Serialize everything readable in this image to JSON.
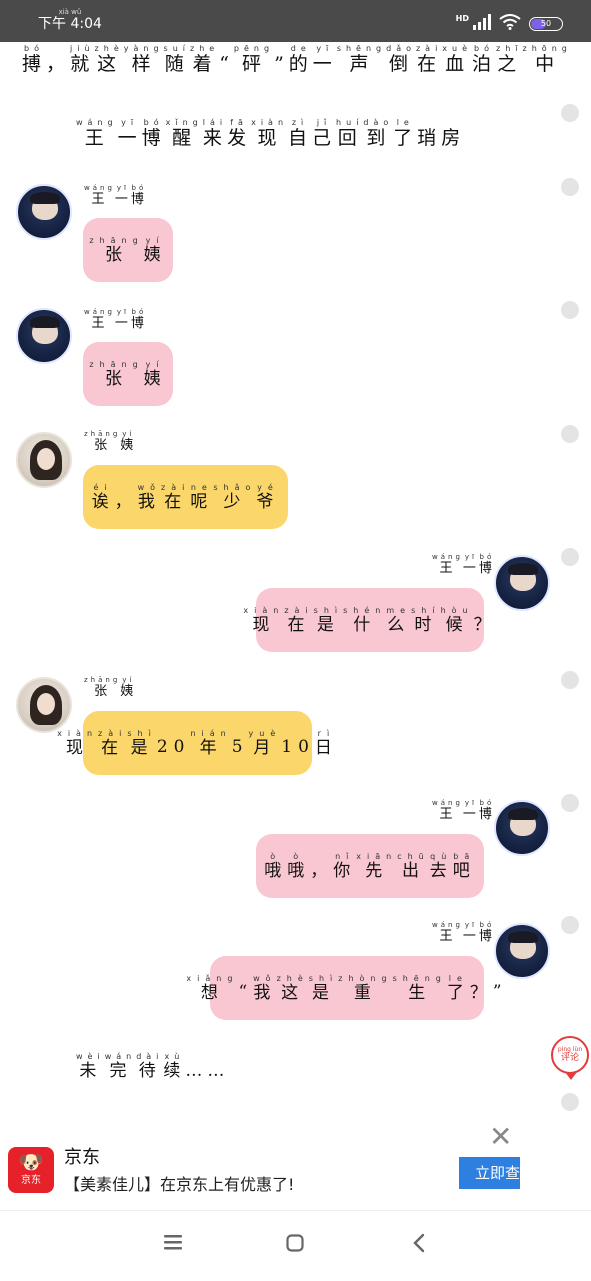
{
  "status_bar": {
    "time": "4:04",
    "time_prefix": "下午",
    "time_prefix_pinyin": "xià wǔ",
    "network": "HD",
    "battery": "50",
    "battery_level": 0.5
  },
  "story": {
    "lines": [
      {
        "chars": [
          [
            "搏",
            "bó"
          ],
          [
            "，",
            ""
          ],
          [
            "就",
            "jiù"
          ],
          [
            "这",
            "zhè"
          ],
          [
            "样",
            "yàng"
          ],
          [
            "随",
            "suí"
          ],
          [
            "着",
            "zhe"
          ],
          [
            "“",
            ""
          ],
          [
            "砰",
            "pēng"
          ],
          [
            "”",
            ""
          ],
          [
            "的",
            "de"
          ],
          [
            "一",
            "yī"
          ],
          [
            "声",
            "shēng"
          ],
          [
            "倒",
            "dǎo"
          ],
          [
            "在",
            "zài"
          ],
          [
            "血",
            "xuè"
          ],
          [
            "泊",
            "bó"
          ],
          [
            "之",
            "zhī"
          ],
          [
            "中",
            "zhōng"
          ]
        ]
      },
      {
        "chars": [
          [
            "王",
            "wáng"
          ],
          [
            "一",
            "yī"
          ],
          [
            "博",
            "bó"
          ],
          [
            "醒",
            "xǐng"
          ],
          [
            "来",
            "lái"
          ],
          [
            "发",
            "fā"
          ],
          [
            "现",
            "xiàn"
          ],
          [
            "自",
            "zì"
          ],
          [
            "己",
            "jǐ"
          ],
          [
            "回",
            "huí"
          ],
          [
            "到",
            "dào"
          ],
          [
            "了",
            "le"
          ],
          [
            "琑",
            ""
          ],
          [
            "房",
            ""
          ]
        ]
      }
    ],
    "ending": [
      [
        "未",
        "wèi"
      ],
      [
        "完",
        "wán"
      ],
      [
        "待",
        "dài"
      ],
      [
        "续",
        "xù"
      ],
      [
        "……",
        ""
      ]
    ]
  },
  "messages": [
    {
      "side": "left",
      "avatar": "boy-avatar",
      "name": [
        [
          "王",
          "wáng"
        ],
        [
          "一",
          "yī"
        ],
        [
          "博",
          "bó"
        ]
      ],
      "color": "pink",
      "text": [
        [
          "张",
          "zhāng"
        ],
        [
          "姨",
          "yí"
        ]
      ]
    },
    {
      "side": "left",
      "avatar": "boy-avatar",
      "name": [
        [
          "王",
          "wáng"
        ],
        [
          "一",
          "yī"
        ],
        [
          "博",
          "bó"
        ]
      ],
      "color": "pink",
      "text": [
        [
          "张",
          "zhāng"
        ],
        [
          "姨",
          "yí"
        ]
      ]
    },
    {
      "side": "left",
      "avatar": "girl-avatar",
      "name": [
        [
          "张",
          "zhāng"
        ],
        [
          "姨",
          "yí"
        ]
      ],
      "color": "yellow",
      "text": [
        [
          "诶",
          "éi"
        ],
        [
          "，",
          ""
        ],
        [
          "我",
          "wǒ"
        ],
        [
          "在",
          "zài"
        ],
        [
          "呢",
          "ne"
        ],
        [
          "少",
          "shǎo"
        ],
        [
          "爷",
          "yé"
        ]
      ]
    },
    {
      "side": "right",
      "avatar": "boy-avatar",
      "name": [
        [
          "王",
          "wáng"
        ],
        [
          "一",
          "yī"
        ],
        [
          "博",
          "bó"
        ]
      ],
      "color": "pink",
      "text": [
        [
          "现",
          "xiàn"
        ],
        [
          "在",
          "zài"
        ],
        [
          "是",
          "shì"
        ],
        [
          "什",
          "shén"
        ],
        [
          "么",
          "me"
        ],
        [
          "时",
          "shí"
        ],
        [
          "候",
          "hòu"
        ],
        [
          "？",
          ""
        ]
      ]
    },
    {
      "side": "left",
      "avatar": "girl-avatar",
      "name": [
        [
          "张",
          "zhāng"
        ],
        [
          "姨",
          "yí"
        ]
      ],
      "color": "yellow",
      "text": [
        [
          "现",
          "xiàn"
        ],
        [
          "在",
          "zài"
        ],
        [
          "是",
          "shì"
        ],
        [
          "20",
          ""
        ],
        [
          "年",
          "nián"
        ],
        [
          "5",
          ""
        ],
        [
          "月",
          "yuè"
        ],
        [
          "10",
          ""
        ],
        [
          "日",
          "rì"
        ]
      ]
    },
    {
      "side": "right",
      "avatar": "boy-avatar",
      "name": [
        [
          "王",
          "wáng"
        ],
        [
          "一",
          "yī"
        ],
        [
          "博",
          "bó"
        ]
      ],
      "color": "pink",
      "text": [
        [
          "哦",
          "ò"
        ],
        [
          "哦",
          "ò"
        ],
        [
          "，",
          ""
        ],
        [
          "你",
          "nǐ"
        ],
        [
          "先",
          "xiān"
        ],
        [
          "出",
          "chū"
        ],
        [
          "去",
          "qù"
        ],
        [
          "吧",
          "bā"
        ]
      ]
    },
    {
      "side": "right",
      "avatar": "boy-avatar",
      "name": [
        [
          "王",
          "wáng"
        ],
        [
          "一",
          "yī"
        ],
        [
          "博",
          "bó"
        ]
      ],
      "color": "pink",
      "text": [
        [
          "想",
          "xiǎng"
        ],
        [
          "“",
          ""
        ],
        [
          "我",
          "wǒ"
        ],
        [
          "这",
          "zhè"
        ],
        [
          "是",
          "shì"
        ],
        [
          "重",
          "zhòng"
        ],
        [
          "生",
          "shēng"
        ],
        [
          "了",
          "le"
        ],
        [
          "？",
          ""
        ],
        [
          "”",
          ""
        ]
      ]
    }
  ],
  "comment_button": {
    "label": "评论",
    "pinyin": "píng lùn"
  },
  "ad": {
    "brand": "京东",
    "logo_text": "京东",
    "description": "【美素佳儿】在京东上有优惠了!",
    "cta": "立即查看",
    "colors": {
      "brand": "#e62129",
      "cta": "#2d7fe0"
    }
  },
  "colors": {
    "pink_bubble": "#f9c7d2",
    "yellow_bubble": "#fbd66a",
    "status_bar": "#4a4a4a"
  }
}
